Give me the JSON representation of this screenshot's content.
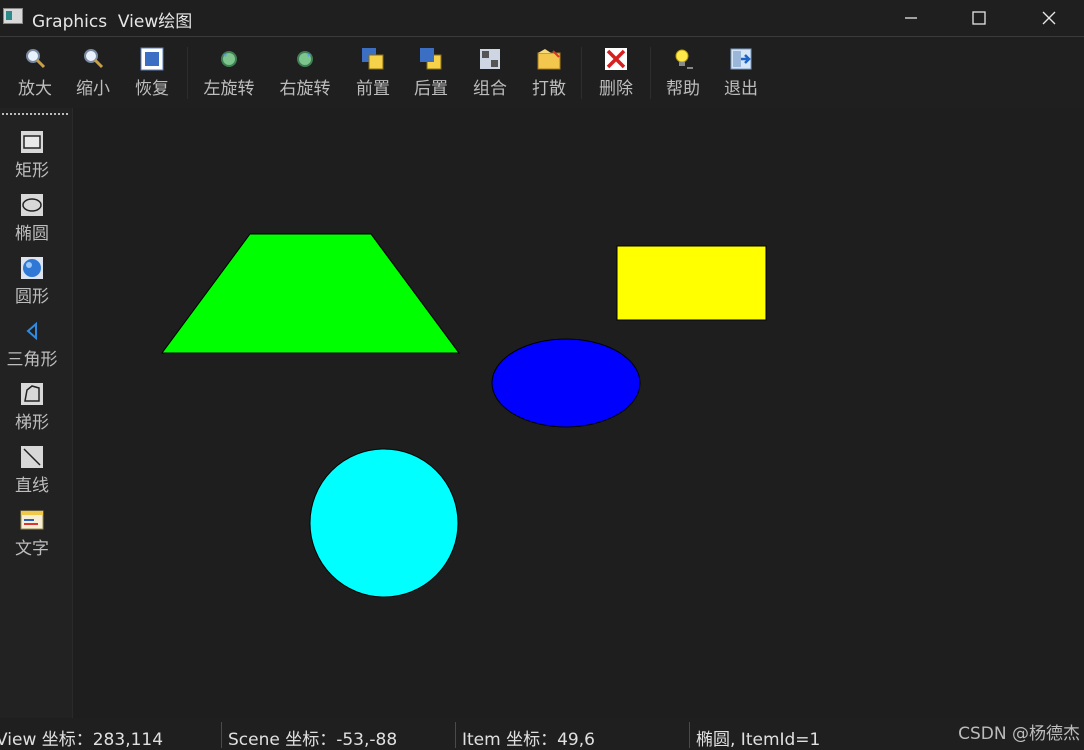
{
  "window": {
    "title": "Graphics  View绘图",
    "controls": {
      "minimize": "minimize",
      "maximize": "maximize",
      "close": "close"
    }
  },
  "toolbar": {
    "zoom_in": "放大",
    "zoom_out": "缩小",
    "restore": "恢复",
    "rotate_left": "左旋转",
    "rotate_right": "右旋转",
    "bring_front": "前置",
    "send_back": "后置",
    "group": "组合",
    "ungroup": "打散",
    "delete": "删除",
    "help": "帮助",
    "exit": "退出"
  },
  "sidebar": {
    "rectangle": "矩形",
    "ellipse": "椭圆",
    "circle": "圆形",
    "triangle": "三角形",
    "trapezoid": "梯形",
    "line": "直线",
    "text": "文字"
  },
  "scene": {
    "shapes": [
      {
        "type": "trapezoid",
        "fill": "#00ff00"
      },
      {
        "type": "rectangle",
        "fill": "#ffff00"
      },
      {
        "type": "ellipse",
        "fill": "#0000ff"
      },
      {
        "type": "circle",
        "fill": "#00ffff"
      }
    ]
  },
  "status": {
    "view_coord": "View 坐标：283,114",
    "scene_coord": "Scene 坐标：-53,-88",
    "item_coord": "Item 坐标：49,6",
    "item_info": "椭圆, ItemId=1"
  },
  "watermark": "CSDN @杨德杰"
}
